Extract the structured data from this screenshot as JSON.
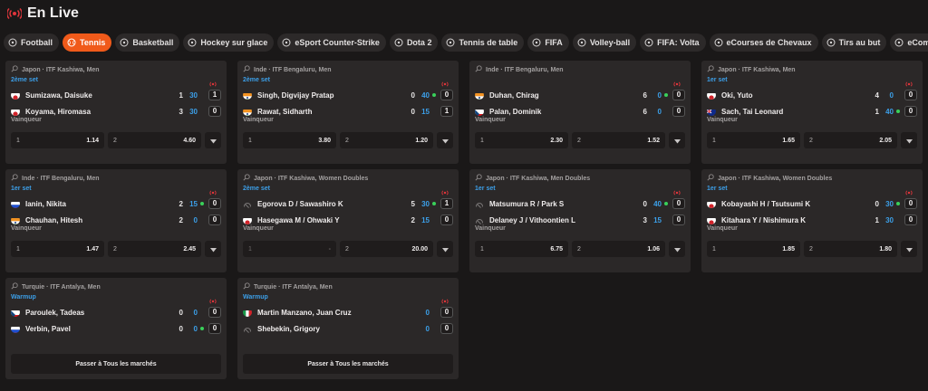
{
  "header": {
    "title": "En Live"
  },
  "tabs": [
    {
      "label": "Football",
      "icon": "football-icon",
      "active": false
    },
    {
      "label": "Tennis",
      "icon": "tennis-icon",
      "active": true
    },
    {
      "label": "Basketball",
      "icon": "basketball-icon",
      "active": false
    },
    {
      "label": "Hockey sur glace",
      "icon": "hockey-icon",
      "active": false
    },
    {
      "label": "eSport Counter-Strike",
      "icon": "gun-icon",
      "active": false
    },
    {
      "label": "Dota 2",
      "icon": "dota-icon",
      "active": false
    },
    {
      "label": "Tennis de table",
      "icon": "table-tennis-icon",
      "active": false
    },
    {
      "label": "FIFA",
      "icon": "fifa-icon",
      "active": false
    },
    {
      "label": "Volley-ball",
      "icon": "volleyball-icon",
      "active": false
    },
    {
      "label": "FIFA: Volta",
      "icon": "fifa-icon",
      "active": false
    },
    {
      "label": "eCourses de Chevaux",
      "icon": "horse-icon",
      "active": false
    },
    {
      "label": "Tirs au but",
      "icon": "goal-icon",
      "active": false
    },
    {
      "label": "eCombat",
      "icon": "combat-icon",
      "active": false
    }
  ],
  "labels": {
    "winner": "Vainqueur",
    "all_markets": "Passer à Tous les marchés"
  },
  "matches": [
    {
      "competition": "Japon · ITF Kashiwa, Men",
      "set": "2ème set",
      "p1": {
        "name": "Sumizawa, Daisuke",
        "flag": "jp",
        "s1": "1",
        "s2": "30",
        "sets": "1",
        "serve": false
      },
      "p2": {
        "name": "Koyama, Hiromasa",
        "flag": "jp",
        "s1": "3",
        "s2": "30",
        "sets": "0",
        "serve": false
      },
      "odds": [
        {
          "k": "1",
          "v": "1.14"
        },
        {
          "k": "2",
          "v": "4.60"
        }
      ]
    },
    {
      "competition": "Inde · ITF Bengaluru, Men",
      "set": "2ème set",
      "p1": {
        "name": "Singh, Digvijay Pratap",
        "flag": "in",
        "s1": "0",
        "s2": "40",
        "sets": "0",
        "serve": true
      },
      "p2": {
        "name": "Rawat, Sidharth",
        "flag": "in",
        "s1": "0",
        "s2": "15",
        "sets": "1",
        "serve": false
      },
      "odds": [
        {
          "k": "1",
          "v": "3.80"
        },
        {
          "k": "2",
          "v": "1.20"
        }
      ]
    },
    {
      "competition": "Inde · ITF Bengaluru, Men",
      "set": "",
      "p1": {
        "name": "Duhan, Chirag",
        "flag": "in",
        "s1": "6",
        "s2": "0",
        "sets": "0",
        "serve": true
      },
      "p2": {
        "name": "Palan, Dominik",
        "flag": "cz",
        "s1": "6",
        "s2": "0",
        "sets": "0",
        "serve": false
      },
      "odds": [
        {
          "k": "1",
          "v": "2.30"
        },
        {
          "k": "2",
          "v": "1.52"
        }
      ]
    },
    {
      "competition": "Japon · ITF Kashiwa, Men",
      "set": "1er set",
      "p1": {
        "name": "Oki, Yuto",
        "flag": "jp",
        "s1": "4",
        "s2": "0",
        "sets": "0",
        "serve": false
      },
      "p2": {
        "name": "Sach, Tai Leonard",
        "flag": "au",
        "s1": "1",
        "s2": "40",
        "sets": "0",
        "serve": true
      },
      "odds": [
        {
          "k": "1",
          "v": "1.65"
        },
        {
          "k": "2",
          "v": "2.05"
        }
      ]
    },
    {
      "competition": "Inde · ITF Bengaluru, Men",
      "set": "1er set",
      "p1": {
        "name": "Ianin, Nikita",
        "flag": "ru",
        "s1": "2",
        "s2": "15",
        "sets": "0",
        "serve": true
      },
      "p2": {
        "name": "Chauhan, Hitesh",
        "flag": "in",
        "s1": "2",
        "s2": "0",
        "sets": "0",
        "serve": false
      },
      "odds": [
        {
          "k": "1",
          "v": "1.47"
        },
        {
          "k": "2",
          "v": "2.45"
        }
      ]
    },
    {
      "competition": "Japon · ITF Kashiwa, Women Doubles",
      "set": "2ème set",
      "p1": {
        "name": "Egorova D / Sawashiro K",
        "flag": "none",
        "s1": "5",
        "s2": "30",
        "sets": "1",
        "serve": true
      },
      "p2": {
        "name": "Hasegawa M / Ohwaki Y",
        "flag": "jp",
        "s1": "2",
        "s2": "15",
        "sets": "0",
        "serve": false
      },
      "odds": [
        {
          "k": "1",
          "v": "-",
          "disabled": true
        },
        {
          "k": "2",
          "v": "20.00"
        }
      ]
    },
    {
      "competition": "Japon · ITF Kashiwa, Men Doubles",
      "set": "1er set",
      "p1": {
        "name": "Matsumura R / Park S",
        "flag": "none",
        "s1": "0",
        "s2": "40",
        "sets": "0",
        "serve": true
      },
      "p2": {
        "name": "Delaney J / Vithoontien L",
        "flag": "none",
        "s1": "3",
        "s2": "15",
        "sets": "0",
        "serve": false
      },
      "odds": [
        {
          "k": "1",
          "v": "6.75"
        },
        {
          "k": "2",
          "v": "1.06"
        }
      ]
    },
    {
      "competition": "Japon · ITF Kashiwa, Women Doubles",
      "set": "1er set",
      "p1": {
        "name": "Kobayashi H / Tsutsumi K",
        "flag": "jp",
        "s1": "0",
        "s2": "30",
        "sets": "0",
        "serve": true
      },
      "p2": {
        "name": "Kitahara Y / Nishimura K",
        "flag": "jp",
        "s1": "1",
        "s2": "30",
        "sets": "0",
        "serve": false
      },
      "odds": [
        {
          "k": "1",
          "v": "1.85"
        },
        {
          "k": "2",
          "v": "1.80"
        }
      ]
    },
    {
      "competition": "Turquie · ITF Antalya, Men",
      "set": "Warmup",
      "p1": {
        "name": "Paroulek, Tadeas",
        "flag": "cz",
        "s1": "0",
        "s2": "0",
        "sets": "0",
        "serve": false
      },
      "p2": {
        "name": "Verbin, Pavel",
        "flag": "ru",
        "s1": "0",
        "s2": "0",
        "sets": "0",
        "serve": true
      },
      "odds": []
    },
    {
      "competition": "Turquie · ITF Antalya, Men",
      "set": "Warmup",
      "p1": {
        "name": "Martin Manzano, Juan Cruz",
        "flag": "it",
        "s1": "",
        "s2": "0",
        "sets": "0",
        "serve": false
      },
      "p2": {
        "name": "Shebekin, Grigory",
        "flag": "none",
        "s1": "",
        "s2": "0",
        "sets": "0",
        "serve": false
      },
      "odds": []
    }
  ],
  "colors": {
    "accent": "#f05a1a",
    "set_blue": "#3c9fe8",
    "serve_green": "#39d15a",
    "live_red": "#e0353b"
  }
}
